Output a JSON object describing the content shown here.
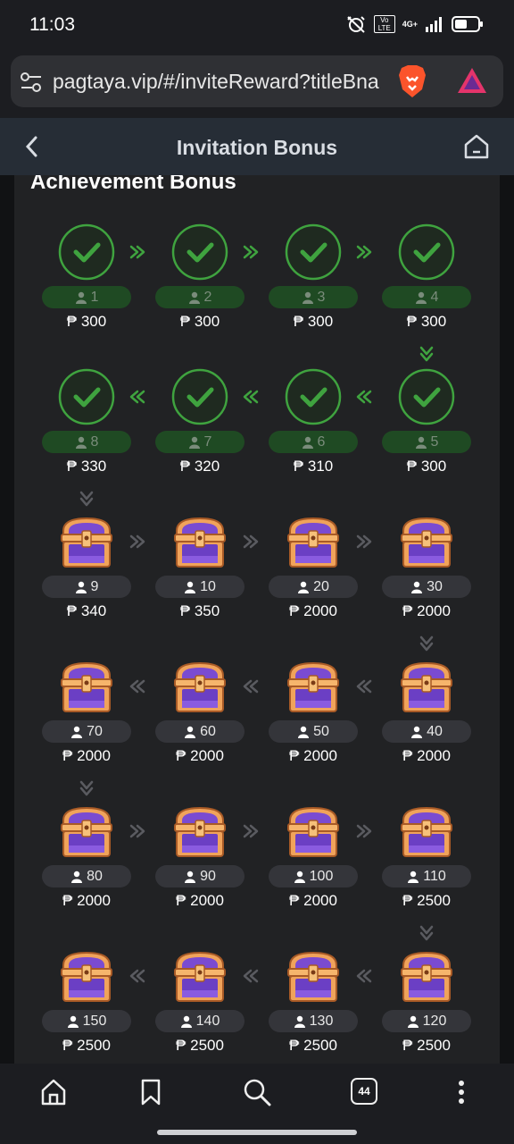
{
  "status_bar": {
    "time": "11:03",
    "network": "4G+",
    "volte": "Vo LTE"
  },
  "browser": {
    "url": "pagtaya.vip/#/inviteReward?titleBna"
  },
  "header": {
    "title": "Invitation Bonus"
  },
  "section": {
    "title": "Achievement Bonus"
  },
  "colors": {
    "completed": "#3fa33f",
    "chest_purple": "#7a4bd1",
    "panel": "#212224"
  },
  "achievements": [
    {
      "count": "1",
      "amount": "₱ 300",
      "status": "completed"
    },
    {
      "count": "2",
      "amount": "₱ 300",
      "status": "completed"
    },
    {
      "count": "3",
      "amount": "₱ 300",
      "status": "completed"
    },
    {
      "count": "4",
      "amount": "₱ 300",
      "status": "completed"
    },
    {
      "count": "5",
      "amount": "₱ 300",
      "status": "completed"
    },
    {
      "count": "6",
      "amount": "₱ 310",
      "status": "completed"
    },
    {
      "count": "7",
      "amount": "₱ 320",
      "status": "completed"
    },
    {
      "count": "8",
      "amount": "₱ 330",
      "status": "completed"
    },
    {
      "count": "9",
      "amount": "₱ 340",
      "status": "locked"
    },
    {
      "count": "10",
      "amount": "₱ 350",
      "status": "locked"
    },
    {
      "count": "20",
      "amount": "₱ 2000",
      "status": "locked"
    },
    {
      "count": "30",
      "amount": "₱ 2000",
      "status": "locked"
    },
    {
      "count": "40",
      "amount": "₱ 2000",
      "status": "locked"
    },
    {
      "count": "50",
      "amount": "₱ 2000",
      "status": "locked"
    },
    {
      "count": "60",
      "amount": "₱ 2000",
      "status": "locked"
    },
    {
      "count": "70",
      "amount": "₱ 2000",
      "status": "locked"
    },
    {
      "count": "80",
      "amount": "₱ 2000",
      "status": "locked"
    },
    {
      "count": "90",
      "amount": "₱ 2000",
      "status": "locked"
    },
    {
      "count": "100",
      "amount": "₱ 2000",
      "status": "locked"
    },
    {
      "count": "110",
      "amount": "₱ 2500",
      "status": "locked"
    },
    {
      "count": "120",
      "amount": "₱ 2500",
      "status": "locked"
    },
    {
      "count": "130",
      "amount": "₱ 2500",
      "status": "locked"
    },
    {
      "count": "140",
      "amount": "₱ 2500",
      "status": "locked"
    },
    {
      "count": "150",
      "amount": "₱ 2500",
      "status": "locked"
    }
  ],
  "bottom_nav": {
    "tab_count": "44"
  }
}
